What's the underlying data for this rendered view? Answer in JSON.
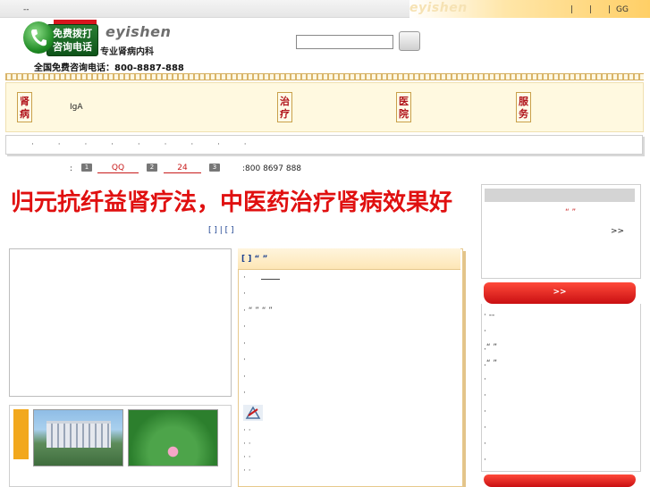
{
  "topbar": {
    "left_text": "--",
    "ghost_logo": "eyishen",
    "links": [
      "|",
      "|",
      "|",
      "GG"
    ]
  },
  "header": {
    "logo_box_text": "免费拨打 咨询电话",
    "logo_en": "eyishen",
    "logo_sub": "专业肾病内科",
    "hotline": "全国免费咨询电话：800-8887-888",
    "search_placeholder": ""
  },
  "nav": {
    "tabs": [
      "肾病",
      "治疗",
      "医院",
      "服务"
    ],
    "iga_label": "IgA"
  },
  "linkbar": {
    "dots": "· · · · · · · · ·"
  },
  "contact": {
    "colon": ":",
    "badges": [
      "1",
      "2",
      "3"
    ],
    "qq_label": "QQ",
    "hours_label": "24",
    "tel": ":800 8697 888"
  },
  "main": {
    "headline": "归元抗纤益肾疗法，中医药治疗肾病效果好",
    "sub_links": "[    ] | [    ]"
  },
  "news": {
    "title": "[  ]     “ ”",
    "items": [
      "·",
      "·",
      "· “ ” “ ”",
      "·",
      "·",
      "·",
      "·",
      "·"
    ],
    "bottom_items": [
      "·                                  ·",
      "·                                  ·",
      "·                                  ·",
      "·                                  ·"
    ]
  },
  "right": {
    "quote": "“ ”",
    "more": ">>",
    "tab1": ">>",
    "list": [
      "·        --",
      "·",
      ".“        ”",
      ".“      ”",
      "·",
      "·",
      "·",
      "·",
      "·",
      "·"
    ]
  },
  "colors": {
    "accent_red": "#e01010",
    "link_blue": "#1a3f8f",
    "tab_orange": "#f2a81d"
  }
}
